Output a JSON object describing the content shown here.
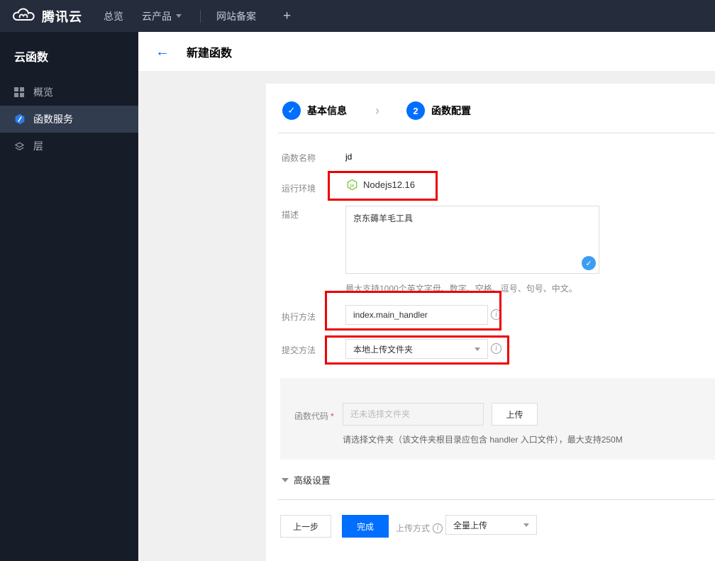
{
  "topbar": {
    "brand": "腾讯云",
    "nav": [
      {
        "label": "总览"
      },
      {
        "label": "云产品"
      },
      {
        "label": "网站备案"
      }
    ],
    "plus": "+"
  },
  "sidebar": {
    "title": "云函数",
    "items": [
      {
        "label": "概览",
        "icon": "grid-icon",
        "active": false
      },
      {
        "label": "函数服务",
        "icon": "scf-hexagon-icon",
        "active": true
      },
      {
        "label": "层",
        "icon": "layers-icon",
        "active": false
      }
    ]
  },
  "header": {
    "title": "新建函数"
  },
  "steps": [
    {
      "mark": "✓",
      "label": "基本信息",
      "state": "done"
    },
    {
      "mark": "2",
      "label": "函数配置",
      "state": "current"
    }
  ],
  "form": {
    "name_label": "函数名称",
    "name_value": "jd",
    "runtime_label": "运行环境",
    "runtime_value": "Nodejs12.16",
    "desc_label": "描述",
    "desc_value": "京东薅羊毛工具",
    "desc_help": "最大支持1000个英文字母、数字、空格、逗号、句号、中文。",
    "handler_label": "执行方法",
    "handler_value": "index.main_handler",
    "submit_label": "提交方法",
    "submit_value": "本地上传文件夹",
    "code_label": "函数代码",
    "code_required": "*",
    "code_placeholder": "还未选择文件夹",
    "upload_button": "上传",
    "code_help": "请选择文件夹（该文件夹根目录应包含 handler 入口文件），最大支持250M",
    "advanced_label": "高级设置"
  },
  "footer": {
    "prev": "上一步",
    "done": "完成",
    "upload_mode_label": "上传方式",
    "upload_mode_value": "全量上传"
  },
  "icons": {
    "back": "←",
    "check": "✓",
    "chevron_right": "›",
    "info": "i",
    "node_text": "js"
  },
  "colors": {
    "accent_blue": "#006eff",
    "light_blue_check": "#3d9df3",
    "annotation_red": "#ec0000",
    "node_green": "#8cc84b",
    "topbar_bg": "#252c3b",
    "sidebar_bg": "#171d28",
    "sidebar_active_bg": "#313c4e",
    "content_bg": "#f0f0f0",
    "code_block_bg": "#f5f5f5"
  }
}
